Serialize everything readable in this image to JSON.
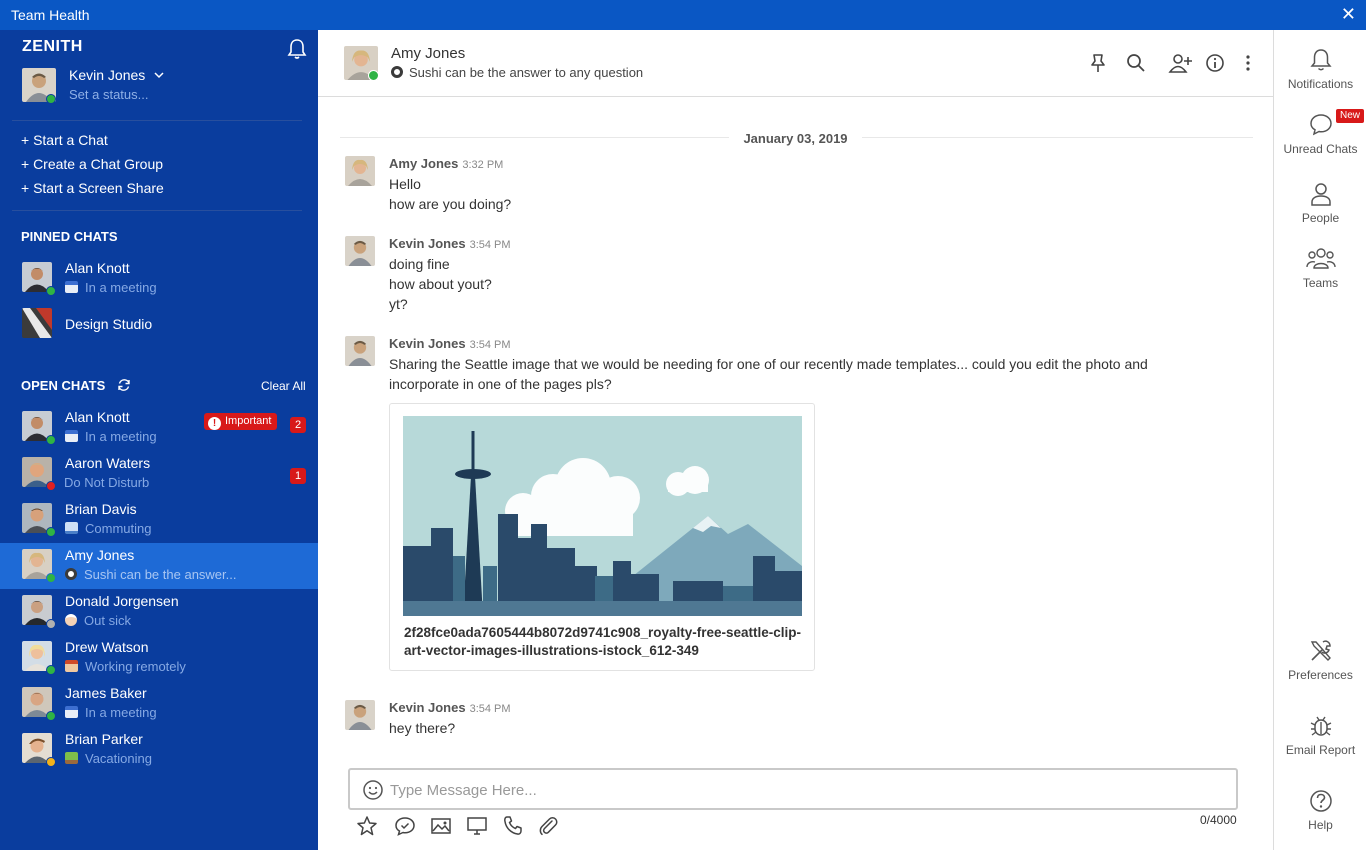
{
  "window": {
    "title": "Team Health",
    "close_glyph": "✕"
  },
  "sidebar": {
    "brand": "ZENITH",
    "me": {
      "name": "Kevin Jones",
      "status_placeholder": "Set a status..."
    },
    "actions": [
      "+ Start a Chat",
      "+ Create a Chat Group",
      "+ Start a Screen Share"
    ],
    "pinned_title": "PINNED CHATS",
    "pinned": [
      {
        "name": "Alan Knott",
        "status": "In a meeting"
      },
      {
        "name": "Design Studio",
        "status": ""
      }
    ],
    "open_title": "OPEN CHATS",
    "clear_all": "Clear All",
    "open": [
      {
        "name": "Alan Knott",
        "status": "In a meeting",
        "badge": "Important",
        "count": "2"
      },
      {
        "name": "Aaron Waters",
        "status": "Do Not Disturb",
        "count": "1"
      },
      {
        "name": "Brian Davis",
        "status": "Commuting"
      },
      {
        "name": "Amy Jones",
        "status": "Sushi can be the answer..."
      },
      {
        "name": "Donald Jorgensen",
        "status": "Out sick"
      },
      {
        "name": "Drew Watson",
        "status": "Working remotely"
      },
      {
        "name": "James Baker",
        "status": "In a meeting"
      },
      {
        "name": "Brian Parker",
        "status": "Vacationing"
      }
    ]
  },
  "header": {
    "name": "Amy Jones",
    "status": "Sushi can be the answer to any question"
  },
  "conversation": {
    "date": "January 03, 2019",
    "messages": [
      {
        "author": "Amy Jones",
        "time": "3:32 PM",
        "lines": [
          "Hello",
          "how are you doing?"
        ]
      },
      {
        "author": "Kevin Jones",
        "time": "3:54 PM",
        "lines": [
          "doing fine",
          "how about yout?",
          "yt?"
        ]
      },
      {
        "author": "Kevin Jones",
        "time": "3:54 PM",
        "lines": [
          "Sharing the Seattle image that we would be needing for one of our recently made templates... could you edit the photo and",
          "incorporate in one of the pages pls?"
        ]
      },
      {
        "author": "Kevin Jones",
        "time": "3:54 PM",
        "lines": [
          "hey there?"
        ]
      }
    ],
    "attachment": {
      "filename": "2f28fce0ada7605444b8072d9741c908_royalty-free-seattle-clip-art-vector-images-illustrations-istock_612-349"
    }
  },
  "composer": {
    "placeholder": "Type Message Here...",
    "value": "",
    "counter": "0/4000"
  },
  "rail": {
    "items": [
      {
        "label": "Notifications"
      },
      {
        "label": "Unread Chats",
        "badge": "New"
      },
      {
        "label": "People"
      },
      {
        "label": "Teams"
      },
      {
        "label": "Preferences"
      },
      {
        "label": "Email Report"
      },
      {
        "label": "Help"
      }
    ]
  },
  "colors": {
    "brand_blue": "#0a3d9e",
    "titlebar": "#0a57c4",
    "active_row": "#1e6ad6",
    "alert_red": "#d81919",
    "online": "#2fb344"
  }
}
